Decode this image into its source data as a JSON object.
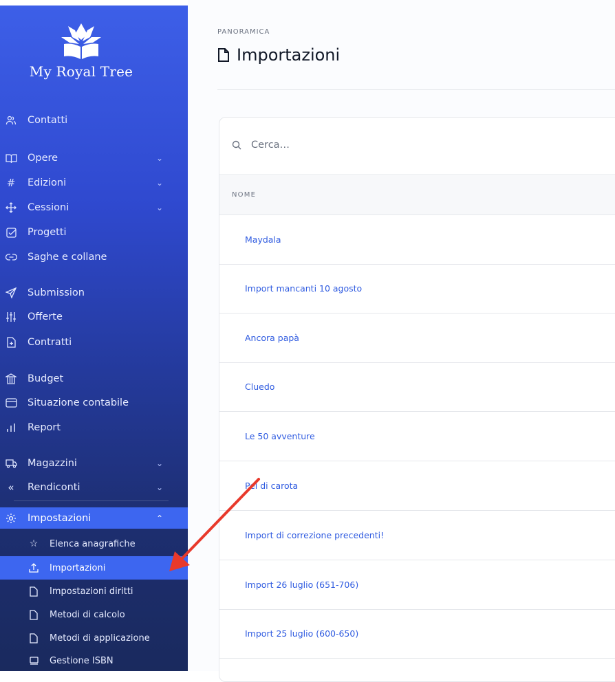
{
  "brand": {
    "name": "My Royal Tree"
  },
  "sidebar": {
    "items": [
      {
        "label": "Contatti",
        "icon": "contacts-icon"
      },
      {
        "label": "Opere",
        "icon": "book-icon"
      },
      {
        "label": "Edizioni",
        "icon": "hash-icon"
      },
      {
        "label": "Cessioni",
        "icon": "move-icon"
      },
      {
        "label": "Progetti",
        "icon": "checkbox-icon"
      },
      {
        "label": "Saghe e collane",
        "icon": "link-icon"
      },
      {
        "label": "Submission",
        "icon": "send-icon"
      },
      {
        "label": "Offerte",
        "icon": "sliders-icon"
      },
      {
        "label": "Contratti",
        "icon": "document-plus-icon"
      },
      {
        "label": "Budget",
        "icon": "bank-icon"
      },
      {
        "label": "Situazione contabile",
        "icon": "credit-card-icon"
      },
      {
        "label": "Report",
        "icon": "bar-chart-icon"
      },
      {
        "label": "Magazzini",
        "icon": "truck-icon"
      },
      {
        "label": "Rendiconti",
        "icon": "double-chevron-left-icon"
      },
      {
        "label": "Impostazioni",
        "icon": "gear-icon"
      }
    ],
    "subitems": [
      {
        "label": "Elenca anagrafiche",
        "icon": "star-icon"
      },
      {
        "label": "Importazioni",
        "icon": "upload-icon"
      },
      {
        "label": "Impostazioni diritti",
        "icon": "file-icon"
      },
      {
        "label": "Metodi di calcolo",
        "icon": "file-icon"
      },
      {
        "label": "Metodi di applicazione",
        "icon": "file-icon"
      },
      {
        "label": "Gestione ISBN",
        "icon": "square-icon"
      }
    ]
  },
  "header": {
    "breadcrumb": "PANORAMICA",
    "title": "Importazioni"
  },
  "search": {
    "placeholder": "Cerca…"
  },
  "table": {
    "column_header": "NOME",
    "rows": [
      "Maydala",
      "Import mancanti 10 agosto",
      "Ancora papà",
      "Cluedo",
      "Le 50 avventure",
      "Pel di carota",
      "Import di correzione precedenti!",
      "Import 26 luglio (651-706)",
      "Import 25 luglio (600-650)"
    ]
  },
  "colors": {
    "sidebar_top": "#3d5fe8",
    "sidebar_bottom": "#1a2a5e",
    "active": "#3d66f0",
    "link": "#2f5be0",
    "annotation_arrow": "#e8392b"
  }
}
